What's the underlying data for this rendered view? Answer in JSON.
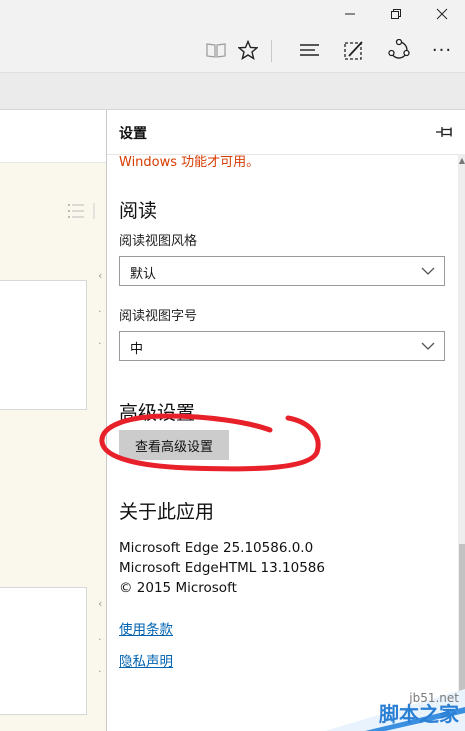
{
  "window": {
    "minimize": "—",
    "restore": "❐",
    "close": "✕"
  },
  "toolbar": {
    "icons": [
      "reading-view-icon",
      "favorite-star-icon",
      "hub-icon",
      "web-note-icon",
      "share-icon",
      "more-icon"
    ],
    "more": "···"
  },
  "settings": {
    "title": "设置",
    "warning": "Windows 功能才可用。",
    "reading": {
      "heading": "阅读",
      "style_label": "阅读视图风格",
      "style_value": "默认",
      "font_label": "阅读视图字号",
      "font_value": "中"
    },
    "advanced": {
      "heading": "高级设置",
      "button": "查看高级设置"
    },
    "about": {
      "heading": "关于此应用",
      "version": "Microsoft Edge 25.10586.0.0",
      "html_version": "Microsoft EdgeHTML 13.10586",
      "copyright": "© 2015 Microsoft",
      "terms": "使用条款",
      "privacy": "隐私声明"
    }
  },
  "annotation": {
    "color": "#e8202a"
  },
  "watermark": {
    "site": "jb51.net",
    "name": "脚本之家"
  },
  "colors": {
    "warning": "#d83b01",
    "link": "#0063b1",
    "button": "#cccccc"
  }
}
